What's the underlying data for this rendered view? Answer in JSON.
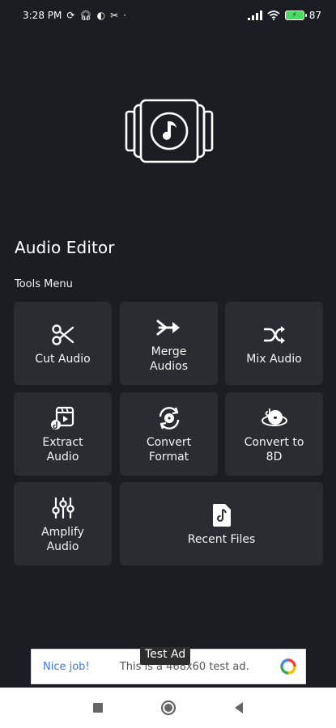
{
  "status": {
    "time": "3:28 PM",
    "battery": "87"
  },
  "app": {
    "title": "Audio Editor",
    "section": "Tools Menu"
  },
  "tools": [
    {
      "label": "Cut Audio",
      "icon": "scissors-icon"
    },
    {
      "label": "Merge\nAudios",
      "icon": "merge-icon"
    },
    {
      "label": "Mix Audio",
      "icon": "shuffle-icon"
    },
    {
      "label": "Extract\nAudio",
      "icon": "extract-video-icon"
    },
    {
      "label": "Convert\nFormat",
      "icon": "convert-format-icon"
    },
    {
      "label": "Convert to\n8D",
      "icon": "8d-audio-icon"
    },
    {
      "label": "Amplify\nAudio",
      "icon": "equalizer-icon"
    },
    {
      "label": "Recent Files",
      "icon": "music-file-icon"
    }
  ],
  "ad": {
    "label": "Test Ad",
    "nice": "Nice job!",
    "text": "This is a 468x60 test ad."
  },
  "colors": {
    "background": "#1c1d22",
    "tile": "#2b2c31",
    "accent": "#ffffff"
  }
}
